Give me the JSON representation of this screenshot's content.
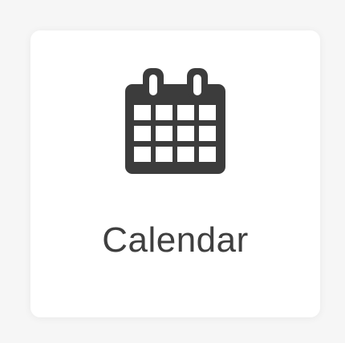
{
  "tile": {
    "label": "Calendar",
    "icon": "calendar-icon"
  },
  "colors": {
    "icon": "#3c3c3c",
    "label": "#3f3f3f",
    "tile_background": "#ffffff",
    "page_background": "#f6f6f6"
  }
}
